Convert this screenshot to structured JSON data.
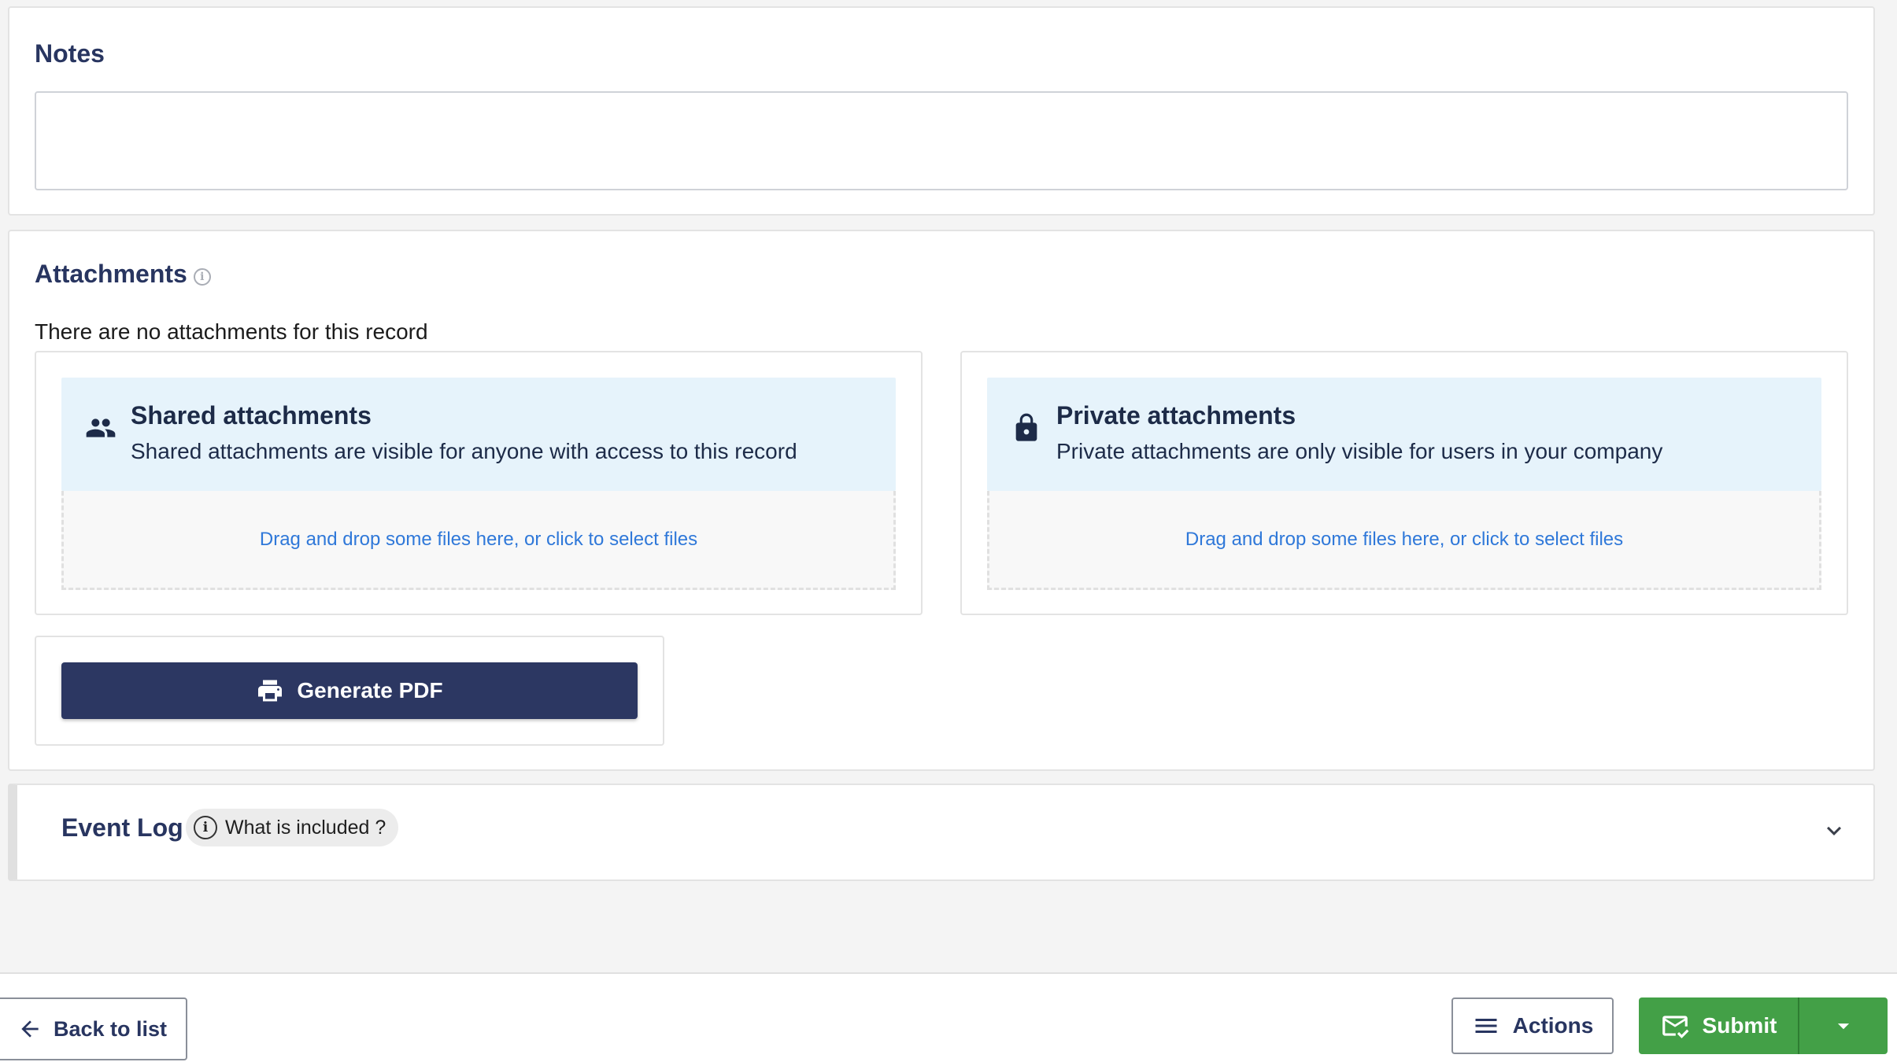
{
  "notes": {
    "title": "Notes",
    "value": "",
    "placeholder": ""
  },
  "attachments": {
    "title": "Attachments",
    "info_icon": "info-icon",
    "empty_message": "There are no attachments for this record",
    "shared": {
      "icon": "people-icon",
      "title": "Shared attachments",
      "description": "Shared attachments are visible for anyone with access to this record",
      "dropzone": "Drag and drop some files here, or click to select files"
    },
    "private": {
      "icon": "lock-icon",
      "title": "Private attachments",
      "description": "Private attachments are only visible for users in your company",
      "dropzone": "Drag and drop some files here, or click to select files"
    },
    "generate_pdf": {
      "icon": "printer-icon",
      "label": "Generate PDF"
    }
  },
  "event_log": {
    "title": "Event Log",
    "chip_label": "What is included ?",
    "chip_icon": "info-icon",
    "expand_icon": "chevron-down-icon"
  },
  "footer": {
    "back_label": "Back to list",
    "back_icon": "arrow-left-icon",
    "actions_label": "Actions",
    "actions_icon": "menu-icon",
    "submit_label": "Submit",
    "submit_icon": "mail-check-icon",
    "submit_dropdown_icon": "caret-down-icon"
  },
  "colors": {
    "primary_navy": "#2c3762",
    "title_navy": "#283560",
    "link_blue": "#2f78d9",
    "attachment_header_bg": "#e6f3fb",
    "submit_green": "#43a047",
    "page_bg": "#f4f4f4"
  }
}
